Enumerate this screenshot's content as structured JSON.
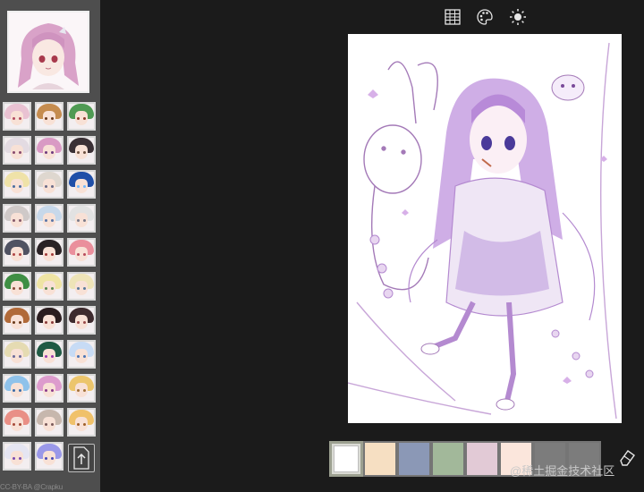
{
  "toolbar": {
    "icons": [
      "grid-table-icon",
      "palette-icon",
      "brightness-icon"
    ]
  },
  "sidebar": {
    "credit": "CC-BY-BA @Crapku",
    "thumbnails": [
      {
        "hair": "#e9c2d2",
        "eye": "#b24a5f"
      },
      {
        "hair": "#c58c4f",
        "eye": "#6b3b1f"
      },
      {
        "hair": "#4f9a53",
        "eye": "#8a3c2c"
      },
      {
        "hair": "#e3dbe2",
        "eye": "#8a4a6e"
      },
      {
        "hair": "#d99ac4",
        "eye": "#6e3a7e"
      },
      {
        "hair": "#3a3035",
        "eye": "#6b5040"
      },
      {
        "hair": "#efe2a8",
        "eye": "#4a6ea0"
      },
      {
        "hair": "#ded7cf",
        "eye": "#6a6a88"
      },
      {
        "hair": "#1f4fa8",
        "eye": "#6fb8ff"
      },
      {
        "hair": "#cfc9c8",
        "eye": "#855a6a"
      },
      {
        "hair": "#c7d8ea",
        "eye": "#5a74a6"
      },
      {
        "hair": "#e2e2e2",
        "eye": "#7a7a8a"
      },
      {
        "hair": "#505262",
        "eye": "#b04646"
      },
      {
        "hair": "#2a2225",
        "eye": "#a03a3a"
      },
      {
        "hair": "#ea8f9c",
        "eye": "#b84c5c"
      },
      {
        "hair": "#3f8e44",
        "eye": "#8a4a3a"
      },
      {
        "hair": "#efe4a4",
        "eye": "#5a8a50"
      },
      {
        "hair": "#eee4b8",
        "eye": "#5a7a9a"
      },
      {
        "hair": "#b16a39",
        "eye": "#6a3a1a"
      },
      {
        "hair": "#2b1d1f",
        "eye": "#8a3a3a"
      },
      {
        "hair": "#3e2b2e",
        "eye": "#9a4a4a"
      },
      {
        "hair": "#e5dbb2",
        "eye": "#6a6a9a"
      },
      {
        "hair": "#1f5a44",
        "eye": "#9a3ab0"
      },
      {
        "hair": "#c7dbf5",
        "eye": "#4a74b6"
      },
      {
        "hair": "#8fc2ea",
        "eye": "#3a6aa6"
      },
      {
        "hair": "#dd9ccd",
        "eye": "#8a3a8a"
      },
      {
        "hair": "#ecc56c",
        "eye": "#a0703a"
      },
      {
        "hair": "#e98f86",
        "eye": "#a64a3a"
      },
      {
        "hair": "#c7b7ad",
        "eye": "#7a5a5a"
      },
      {
        "hair": "#f0c16a",
        "eye": "#a0602a"
      },
      {
        "hair": "#e5e5f2",
        "eye": "#7a4ab0"
      },
      {
        "hair": "#9a98e8",
        "eye": "#4a4ab6"
      }
    ]
  },
  "palette": {
    "colors": [
      "#ffffff",
      "#f6dfc2",
      "#8b98b6",
      "#a2b89a",
      "#e2cad6",
      "#fbe6dc",
      "#7c7c7c",
      "#7c7c7c"
    ]
  },
  "watermark": "@稀土掘金技术社区"
}
